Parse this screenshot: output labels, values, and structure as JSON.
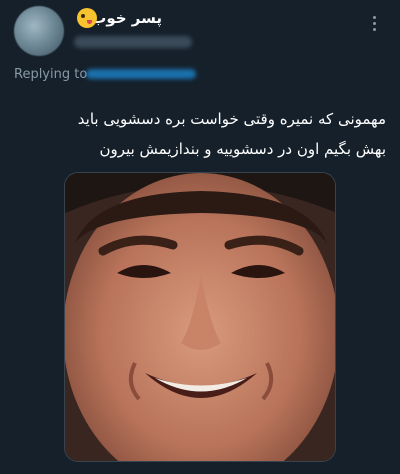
{
  "tweet": {
    "author": {
      "display_name": "پسر خوب",
      "emoji_icon": "grinning-squinting-tongue-face"
    },
    "reply_context": {
      "label": "Replying to"
    },
    "text_lines": [
      "مهمونی که نمیره وقتی خواست بره دسشویی باید",
      "بهش بگیم اون در دسشوییه و بندازیمش بیرون"
    ],
    "media": {
      "icon": "smiling-man-face-photo"
    }
  },
  "colors": {
    "background": "#15202b",
    "text": "#ffffff",
    "secondary_text": "#8899a6",
    "link": "#1d9bf0"
  }
}
